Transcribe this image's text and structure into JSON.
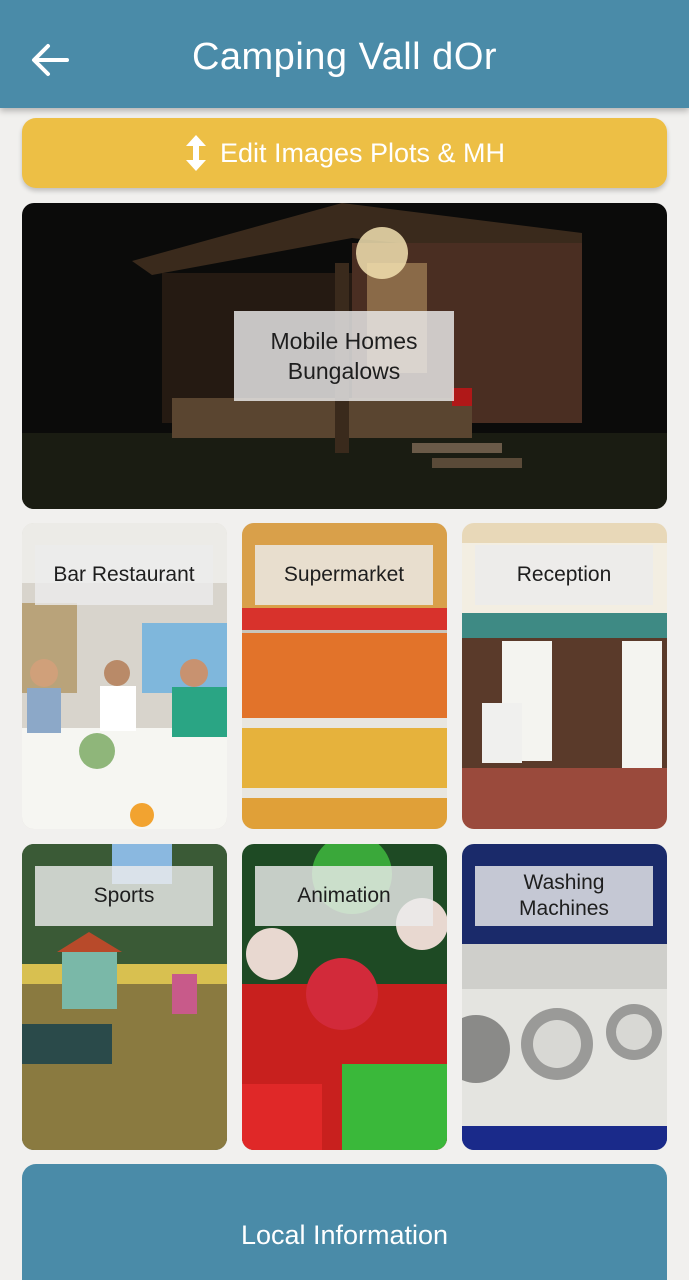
{
  "header": {
    "title": "Camping Vall dOr",
    "back_icon": "arrow-left-icon"
  },
  "edit_button": {
    "label": "Edit Images Plots & MH",
    "icon": "swap-vertical-icon",
    "color": "#edbf45"
  },
  "tiles": [
    {
      "label": "Mobile Homes Bungalows"
    },
    {
      "label": "Bar Restaurant"
    },
    {
      "label": "Supermarket"
    },
    {
      "label": "Reception"
    },
    {
      "label": "Sports"
    },
    {
      "label": "Animation"
    },
    {
      "label": "Washing Machines"
    }
  ],
  "footer": {
    "label": "Local Information"
  },
  "colors": {
    "primary": "#4a8ba8",
    "accent": "#edbf45",
    "background": "#f1f0ee"
  }
}
